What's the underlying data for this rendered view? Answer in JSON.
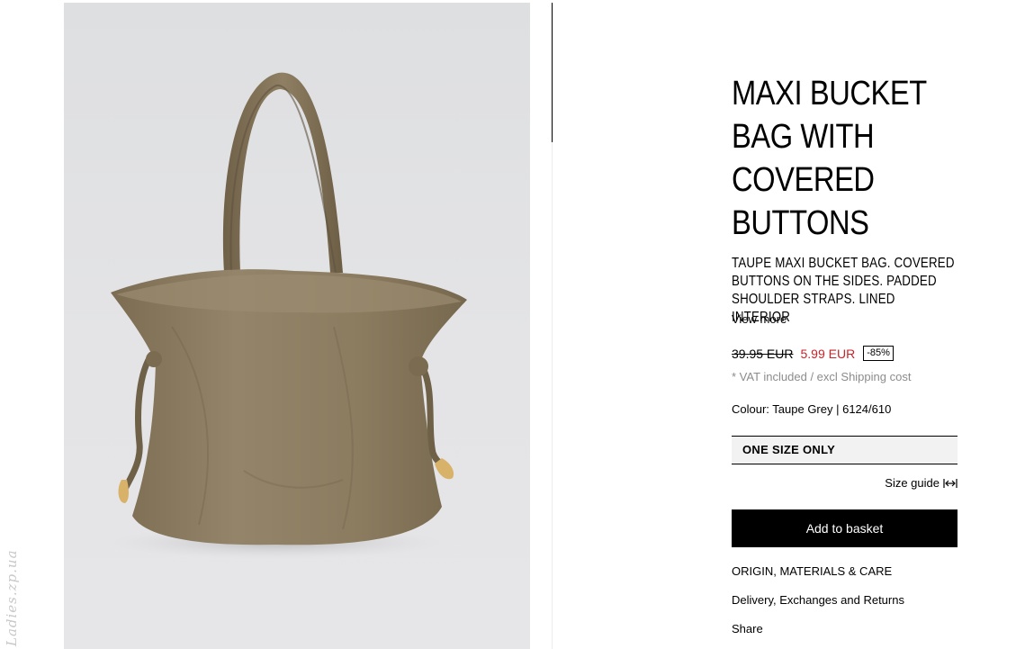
{
  "product": {
    "image_alt": "Taupe maxi bucket bag photo",
    "title": "MAXI BUCKET BAG WITH COVERED BUTTONS",
    "description": "TAUPE MAXI BUCKET BAG. COVERED BUTTONS ON THE SIDES. PADDED SHOULDER STRAPS. LINED INTERIOR",
    "view_more": "View more",
    "old_price": "39.95 EUR",
    "new_price": "5.99 EUR",
    "discount": "-85%",
    "vat_note": "* VAT included / excl Shipping cost",
    "colour": "Colour: Taupe Grey | 6124/610",
    "size": "ONE SIZE ONLY",
    "size_guide": "Size guide",
    "add_to_basket": "Add to basket"
  },
  "links": {
    "origin": "ORIGIN, MATERIALS & CARE",
    "delivery": "Delivery, Exchanges and Returns",
    "share": "Share"
  },
  "watermark": "Ladies.zp.ua",
  "colors": {
    "accent": "#000000",
    "sale": "#c5252b",
    "bag": "#8a7a5e",
    "background": "#e2e2e4"
  },
  "icons": {
    "size_guide": "horizontal-arrows-icon"
  }
}
